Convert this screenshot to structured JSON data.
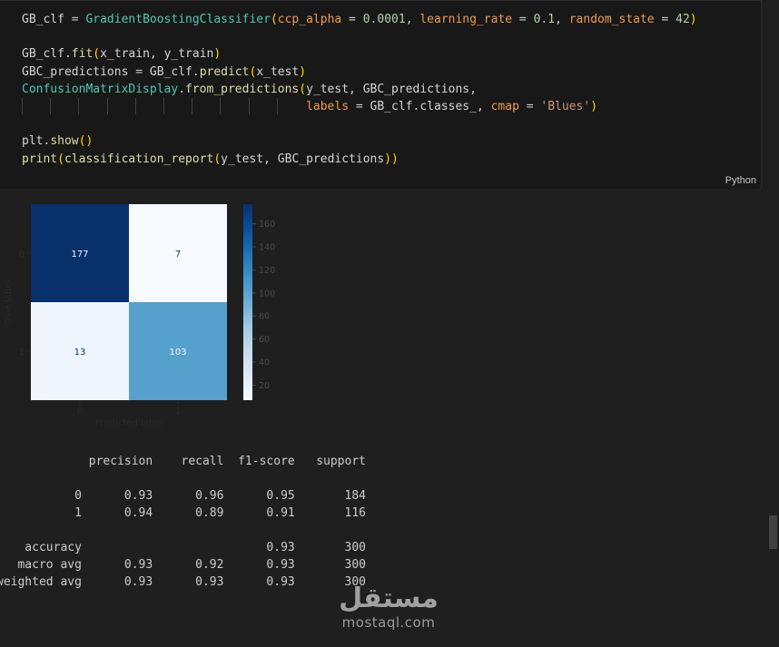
{
  "code_cell": {
    "language_label": "Python",
    "lines": [
      [
        {
          "t": "GB_clf",
          "c": "var"
        },
        {
          "t": " = ",
          "c": "op"
        },
        {
          "t": "GradientBoostingClassifier",
          "c": "cls"
        },
        {
          "t": "(",
          "c": "par"
        },
        {
          "t": "ccp_alpha",
          "c": "prm"
        },
        {
          "t": " = ",
          "c": "op"
        },
        {
          "t": "0.0001",
          "c": "num"
        },
        {
          "t": ", ",
          "c": "op"
        },
        {
          "t": "learning_rate",
          "c": "prm"
        },
        {
          "t": " = ",
          "c": "op"
        },
        {
          "t": "0.1",
          "c": "num"
        },
        {
          "t": ", ",
          "c": "op"
        },
        {
          "t": "random_state",
          "c": "prm"
        },
        {
          "t": " = ",
          "c": "op"
        },
        {
          "t": "42",
          "c": "num"
        },
        {
          "t": ")",
          "c": "par"
        }
      ],
      [],
      [
        {
          "t": "GB_clf",
          "c": "var"
        },
        {
          "t": ".",
          "c": "op"
        },
        {
          "t": "fit",
          "c": "fn"
        },
        {
          "t": "(",
          "c": "par"
        },
        {
          "t": "x_train",
          "c": "var"
        },
        {
          "t": ", ",
          "c": "op"
        },
        {
          "t": "y_train",
          "c": "var"
        },
        {
          "t": ")",
          "c": "par"
        }
      ],
      [
        {
          "t": "GBC_predictions",
          "c": "var"
        },
        {
          "t": " = ",
          "c": "op"
        },
        {
          "t": "GB_clf",
          "c": "var"
        },
        {
          "t": ".",
          "c": "op"
        },
        {
          "t": "predict",
          "c": "fn"
        },
        {
          "t": "(",
          "c": "par"
        },
        {
          "t": "x_test",
          "c": "var"
        },
        {
          "t": ")",
          "c": "par"
        }
      ],
      [
        {
          "t": "ConfusionMatrixDisplay",
          "c": "cls"
        },
        {
          "t": ".",
          "c": "op"
        },
        {
          "t": "from_predictions",
          "c": "fn"
        },
        {
          "t": "(",
          "c": "par"
        },
        {
          "t": "y_test",
          "c": "var"
        },
        {
          "t": ", ",
          "c": "op"
        },
        {
          "t": "GBC_predictions",
          "c": "var"
        },
        {
          "t": ",",
          "c": "op"
        }
      ],
      [
        {
          "t": "                                        ",
          "c": "op"
        },
        {
          "t": "labels",
          "c": "prm"
        },
        {
          "t": " = ",
          "c": "op"
        },
        {
          "t": "GB_clf",
          "c": "var"
        },
        {
          "t": ".",
          "c": "op"
        },
        {
          "t": "classes_",
          "c": "var"
        },
        {
          "t": ", ",
          "c": "op"
        },
        {
          "t": "cmap",
          "c": "prm"
        },
        {
          "t": " = ",
          "c": "op"
        },
        {
          "t": "'Blues'",
          "c": "str"
        },
        {
          "t": ")",
          "c": "par"
        }
      ],
      [],
      [
        {
          "t": "plt",
          "c": "var"
        },
        {
          "t": ".",
          "c": "op"
        },
        {
          "t": "show",
          "c": "fn"
        },
        {
          "t": "()",
          "c": "par"
        }
      ],
      [
        {
          "t": "print",
          "c": "fn"
        },
        {
          "t": "(",
          "c": "par"
        },
        {
          "t": "classification_report",
          "c": "fn"
        },
        {
          "t": "(",
          "c": "par"
        },
        {
          "t": "y_test",
          "c": "var"
        },
        {
          "t": ", ",
          "c": "op"
        },
        {
          "t": "GBC_predictions",
          "c": "var"
        },
        {
          "t": "))",
          "c": "par"
        }
      ]
    ]
  },
  "chart_data": {
    "type": "heatmap",
    "xlabel": "Predicted label",
    "ylabel": "True label",
    "x_categories": [
      "0",
      "1"
    ],
    "y_categories": [
      "0",
      "1"
    ],
    "matrix": [
      [
        177,
        7
      ],
      [
        13,
        103
      ]
    ],
    "colormap": "Blues",
    "colorbar_range": [
      7,
      177
    ],
    "colorbar_ticks": [
      20,
      40,
      60,
      80,
      100,
      120,
      140,
      160
    ],
    "grid": false
  },
  "report": {
    "header": [
      "precision",
      "recall",
      "f1-score",
      "support"
    ],
    "rows": [
      {
        "label": "0",
        "values": [
          "0.93",
          "0.96",
          "0.95",
          "184"
        ]
      },
      {
        "label": "1",
        "values": [
          "0.94",
          "0.89",
          "0.91",
          "116"
        ]
      },
      null,
      {
        "label": "accuracy",
        "values": [
          "",
          "",
          "0.93",
          "300"
        ]
      },
      {
        "label": "macro avg",
        "values": [
          "0.93",
          "0.92",
          "0.93",
          "300"
        ]
      },
      {
        "label": "weighted avg",
        "values": [
          "0.93",
          "0.93",
          "0.93",
          "300"
        ]
      }
    ]
  },
  "watermark": {
    "arabic": "مستقل",
    "latin": "mostaql.com"
  },
  "colors": {
    "editor_bg": "#181818",
    "output_bg": "#1f1f1f",
    "keyword_class": "#4ec9b0",
    "function": "#dcdcaa",
    "parameter": "#ef9b4c",
    "number": "#b5cea8",
    "string": "#ce9178",
    "bracket": "#ffd700"
  }
}
